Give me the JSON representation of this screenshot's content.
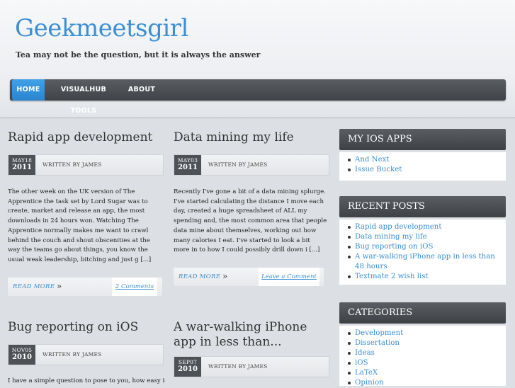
{
  "site": {
    "title": "Geekmeetsgirl",
    "tagline": "Tea may not be the question, but it is always the answer"
  },
  "nav": [
    {
      "label": "HOME"
    },
    {
      "label": "VISUALHUB TOOLS"
    },
    {
      "label": "ABOUT"
    }
  ],
  "posts": [
    {
      "title": "Rapid app development",
      "date_mon": "MAY18",
      "date_year": "2011",
      "author": "WRITTEN BY JAMES",
      "excerpt": "The other week on the UK version of The Apprentice the task set by Lord Sugar was to create, market and release an app, the most downloads in 24 hours won. Watching The Apprentice normally makes me want to crawl behind the couch and shout obscenities at the way the teams go about things, you know the usual weak leadership, bitching and just g [...]",
      "read_more": "READ MORE",
      "comments": "2 Comments"
    },
    {
      "title": "Data mining my life",
      "date_mon": "MAY03",
      "date_year": "2011",
      "author": "WRITTEN BY JAMES",
      "excerpt": "Recently I've gone a bit of a data mining splurge. I've started calculating the distance I move each day, created a huge spreadsheet of ALL my spending and, the most common area that people data mine about themselves, working out how many calories I eat. I've started to look a bit more in to how I could possibly drill down i [...]",
      "read_more": "READ MORE",
      "comments": "Leave a Comment"
    },
    {
      "title": "Bug reporting on iOS",
      "date_mon": "NOV05",
      "date_year": "2010",
      "author": "WRITTEN BY JAMES",
      "excerpt": "I have a simple question to pose to you, how easy is"
    },
    {
      "title": "A war-walking iPhone app in less than...",
      "date_mon": "SEP07",
      "date_year": "2010",
      "author": "WRITTEN BY JAMES"
    }
  ],
  "sidebar": {
    "ios_apps": {
      "title": "MY IOS APPS",
      "items": [
        "And Next",
        "Issue Bucket"
      ]
    },
    "recent_posts": {
      "title": "RECENT POSTS",
      "items": [
        "Rapid app development",
        "Data mining my life",
        "Bug reporting on iOS",
        "A war-walking iPhone app in less than 48 hours",
        "Textmate 2 wish list"
      ]
    },
    "categories": {
      "title": "CATEGORIES",
      "items": [
        "Development",
        "Dissertation",
        "Ideas",
        "iOS",
        "LaTeX",
        "Opinion"
      ]
    }
  },
  "colors": {
    "accent": "#3a8fd6",
    "nav_bg": "#4a4e53",
    "nav_active": "#3797e2",
    "date_box": "#4e5257"
  }
}
